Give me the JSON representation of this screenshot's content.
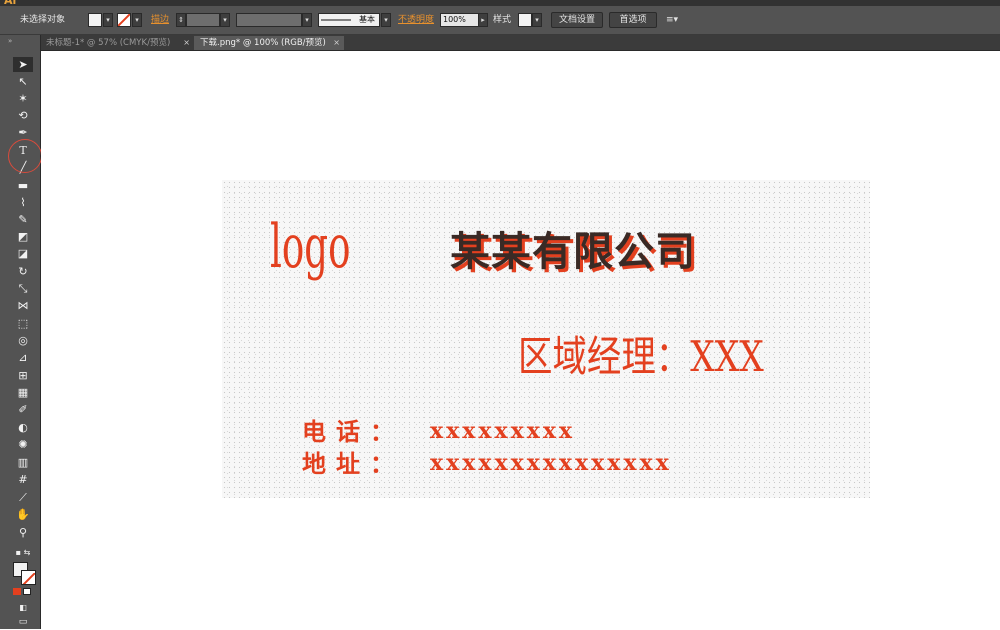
{
  "menubar": {
    "app_icon": "Ai"
  },
  "control": {
    "selection": "未选择对象",
    "stroke_label": "描边",
    "stroke_style": "基本",
    "opacity_label": "不透明度",
    "opacity_value": "100%",
    "style_label": "样式",
    "doc_setup": "文档设置",
    "preferences": "首选项"
  },
  "tabs": [
    {
      "label": "未标题-1* @ 57% (CMYK/预览)",
      "close": "×"
    },
    {
      "label": "下载.png* @ 100% (RGB/预览)",
      "close": "×"
    }
  ],
  "tools": {
    "type_tool": "T"
  },
  "card": {
    "logo": "logo",
    "company": "某某有限公司",
    "manager": "区域经理：XXX",
    "phone_label": "电话：",
    "phone_value": "xxxxxxxxx",
    "address_label": "地址：",
    "address_value": "xxxxxxxxxxxxxxx"
  },
  "colors": {
    "accent": "#e3401f",
    "ui_dark": "#535353"
  }
}
